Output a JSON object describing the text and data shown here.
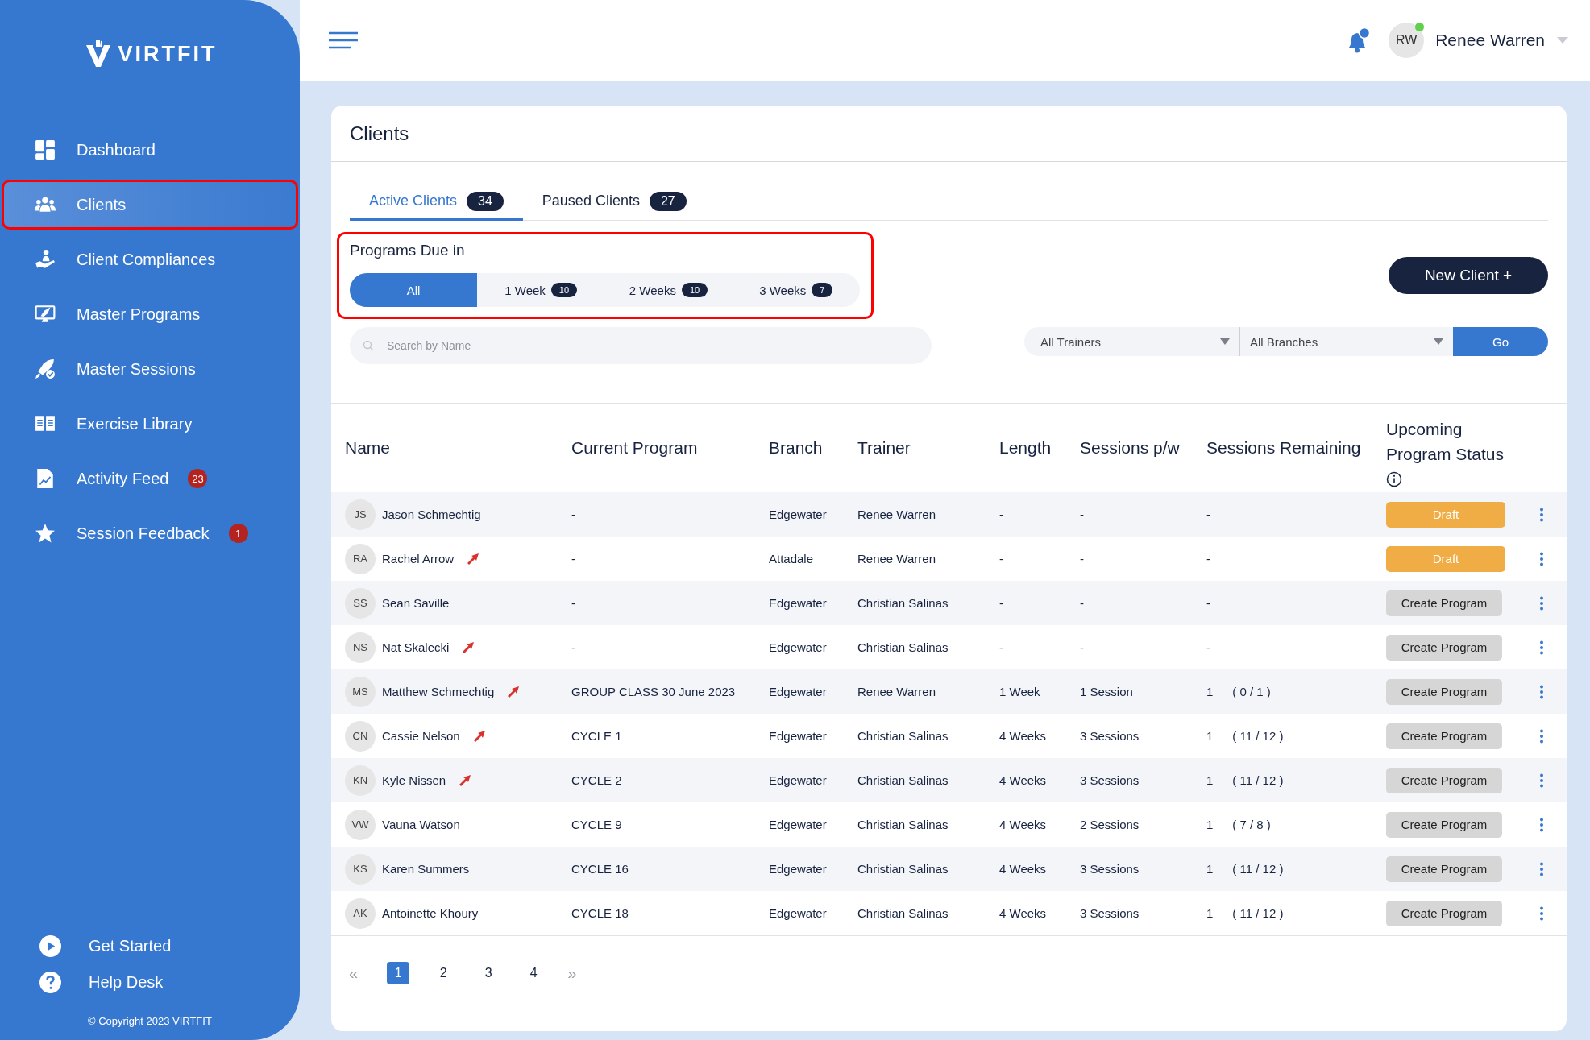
{
  "brand": "VIRTFIT",
  "sidebar": {
    "items": [
      {
        "label": "Dashboard",
        "kind": "grid",
        "selected": false,
        "highlighted": false
      },
      {
        "label": "Clients",
        "kind": "people",
        "selected": true,
        "highlighted": true
      },
      {
        "label": "Client Compliances",
        "kind": "hand",
        "selected": false,
        "highlighted": false
      },
      {
        "label": "Master Programs",
        "kind": "monitor",
        "selected": false,
        "highlighted": false
      },
      {
        "label": "Master Sessions",
        "kind": "rocket",
        "selected": false,
        "highlighted": false
      },
      {
        "label": "Exercise Library",
        "kind": "book",
        "selected": false,
        "highlighted": false
      },
      {
        "label": "Activity Feed",
        "kind": "doc",
        "selected": false,
        "highlighted": false,
        "badge": "23"
      },
      {
        "label": "Session Feedback",
        "kind": "star",
        "selected": false,
        "highlighted": false,
        "badge": "1"
      }
    ],
    "footer_links": [
      {
        "label": "Get Started",
        "kind": "play"
      },
      {
        "label": "Help Desk",
        "kind": "help"
      }
    ],
    "copyright": "© Copyright 2023 VIRTFIT"
  },
  "header": {
    "user": {
      "initials": "RW",
      "name": "Renee Warren",
      "online": true
    }
  },
  "page_title": "Clients",
  "tabs": [
    {
      "label": "Active Clients",
      "count": "34",
      "selected": true
    },
    {
      "label": "Paused Clients",
      "count": "27",
      "selected": false
    }
  ],
  "programs_due": {
    "title": "Programs Due in",
    "highlighted": true,
    "segments": [
      {
        "label": "All",
        "selected": true
      },
      {
        "label": "1 Week",
        "count": "10",
        "selected": false
      },
      {
        "label": "2 Weeks",
        "count": "10",
        "selected": false
      },
      {
        "label": "3 Weeks",
        "count": "7",
        "selected": false
      }
    ]
  },
  "new_client_button": "New Client +",
  "search": {
    "placeholder": "Search by Name"
  },
  "filters": {
    "trainer": "All Trainers",
    "branch": "All Branches",
    "go": "Go"
  },
  "table": {
    "columns": [
      "Name",
      "Current Program",
      "Branch",
      "Trainer",
      "Length",
      "Sessions p/w",
      "Sessions Remaining",
      "Upcoming Program Status"
    ],
    "rows": [
      {
        "initials": "JS",
        "name": "Jason Schmechtig",
        "flagged": false,
        "program": "-",
        "branch": "Edgewater",
        "trainer": "Renee Warren",
        "length": "-",
        "sessions_pw": "-",
        "remaining": "-",
        "status": {
          "kind": "draft",
          "label": "Draft"
        }
      },
      {
        "initials": "RA",
        "name": "Rachel Arrow",
        "flagged": true,
        "program": "-",
        "branch": "Attadale",
        "trainer": "Renee Warren",
        "length": "-",
        "sessions_pw": "-",
        "remaining": "-",
        "status": {
          "kind": "draft",
          "label": "Draft"
        }
      },
      {
        "initials": "SS",
        "name": "Sean Saville",
        "flagged": false,
        "program": "-",
        "branch": "Edgewater",
        "trainer": "Christian Salinas",
        "length": "-",
        "sessions_pw": "-",
        "remaining": "-",
        "status": {
          "kind": "create",
          "label": "Create Program"
        }
      },
      {
        "initials": "NS",
        "name": "Nat Skalecki",
        "flagged": true,
        "program": "-",
        "branch": "Edgewater",
        "trainer": "Christian Salinas",
        "length": "-",
        "sessions_pw": "-",
        "remaining": "-",
        "status": {
          "kind": "create",
          "label": "Create Program"
        }
      },
      {
        "initials": "MS",
        "name": "Matthew Schmechtig",
        "flagged": true,
        "program": "GROUP CLASS 30 June 2023",
        "branch": "Edgewater",
        "trainer": "Renee Warren",
        "length": "1 Week",
        "sessions_pw": "1 Session",
        "remaining": "1",
        "remaining_detail": "( 0 / 1 )",
        "status": {
          "kind": "create",
          "label": "Create Program"
        }
      },
      {
        "initials": "CN",
        "name": "Cassie Nelson",
        "flagged": true,
        "program": "CYCLE 1",
        "branch": "Edgewater",
        "trainer": "Christian Salinas",
        "length": "4 Weeks",
        "sessions_pw": "3 Sessions",
        "remaining": "1",
        "remaining_detail": "( 11 / 12 )",
        "status": {
          "kind": "create",
          "label": "Create Program"
        }
      },
      {
        "initials": "KN",
        "name": "Kyle Nissen",
        "flagged": true,
        "program": "CYCLE 2",
        "branch": "Edgewater",
        "trainer": "Christian Salinas",
        "length": "4 Weeks",
        "sessions_pw": "3 Sessions",
        "remaining": "1",
        "remaining_detail": "( 11 / 12 )",
        "status": {
          "kind": "create",
          "label": "Create Program"
        }
      },
      {
        "initials": "VW",
        "name": "Vauna Watson",
        "flagged": false,
        "program": "CYCLE 9",
        "branch": "Edgewater",
        "trainer": "Christian Salinas",
        "length": "4 Weeks",
        "sessions_pw": "2 Sessions",
        "remaining": "1",
        "remaining_detail": "( 7 / 8 )",
        "status": {
          "kind": "create",
          "label": "Create Program"
        }
      },
      {
        "initials": "KS",
        "name": "Karen Summers",
        "flagged": false,
        "program": "CYCLE 16",
        "branch": "Edgewater",
        "trainer": "Christian Salinas",
        "length": "4 Weeks",
        "sessions_pw": "3 Sessions",
        "remaining": "1",
        "remaining_detail": "( 11 / 12 )",
        "status": {
          "kind": "create",
          "label": "Create Program"
        }
      },
      {
        "initials": "AK",
        "name": "Antoinette Khoury",
        "flagged": false,
        "program": "CYCLE 18",
        "branch": "Edgewater",
        "trainer": "Christian Salinas",
        "length": "4 Weeks",
        "sessions_pw": "3 Sessions",
        "remaining": "1",
        "remaining_detail": "( 11 / 12 )",
        "status": {
          "kind": "create",
          "label": "Create Program"
        }
      }
    ]
  },
  "pagination": {
    "first": "«",
    "last": "»",
    "pages": [
      {
        "label": "1",
        "selected": true
      },
      {
        "label": "2",
        "selected": false
      },
      {
        "label": "3",
        "selected": false
      },
      {
        "label": "4",
        "selected": false
      }
    ]
  }
}
